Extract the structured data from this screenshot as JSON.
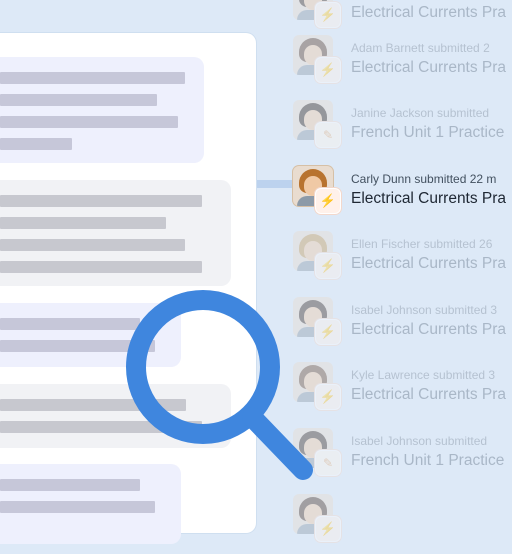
{
  "feed": [
    {
      "avatar": "student-avatar",
      "badge_icon": "lightning-icon",
      "meta": "",
      "title": "Electrical Currents Pra",
      "active": false,
      "hair": "#3d2b20"
    },
    {
      "avatar": "student-avatar",
      "badge_icon": "lightning-icon",
      "meta": "Adam Barnett submitted 2",
      "title": "Electrical Currents Pra",
      "active": false,
      "hair": "#5a3d2a"
    },
    {
      "avatar": "student-avatar",
      "badge_icon": "pencil-icon",
      "meta": "Janine Jackson submitted",
      "title": "French Unit 1 Practice",
      "active": false,
      "hair": "#2b1e17"
    },
    {
      "avatar": "student-avatar",
      "badge_icon": "lightning-icon",
      "meta": "Carly Dunn submitted 22 m",
      "title": "Electrical Currents Pra",
      "active": true,
      "hair": "#b8732f"
    },
    {
      "avatar": "student-avatar",
      "badge_icon": "lightning-icon",
      "meta": "Ellen Fischer submitted 26",
      "title": "Electrical Currents Pra",
      "active": false,
      "hair": "#c49a5a"
    },
    {
      "avatar": "student-avatar",
      "badge_icon": "lightning-icon",
      "meta": "Isabel Johnson submitted 3",
      "title": "Electrical Currents Pra",
      "active": false,
      "hair": "#3a2a22"
    },
    {
      "avatar": "student-avatar",
      "badge_icon": "lightning-icon",
      "meta": "Kyle Lawrence submitted 3",
      "title": "Electrical Currents Pra",
      "active": false,
      "hair": "#6b4a33"
    },
    {
      "avatar": "student-avatar",
      "badge_icon": "pencil-icon",
      "meta": "Isabel Johnson submitted",
      "title": "French Unit 1 Practice",
      "active": false,
      "hair": "#3a2a22"
    },
    {
      "avatar": "student-avatar",
      "badge_icon": "lightning-icon",
      "meta": "",
      "title": "",
      "active": false,
      "hair": "#4a3326"
    }
  ],
  "colors": {
    "accent": "#3f86de",
    "background": "#dde9f7",
    "lightning": "#e6865e"
  },
  "icons": {
    "magnifier": "magnifying-glass-icon",
    "lightning": "⚡",
    "pencil": "✎"
  }
}
